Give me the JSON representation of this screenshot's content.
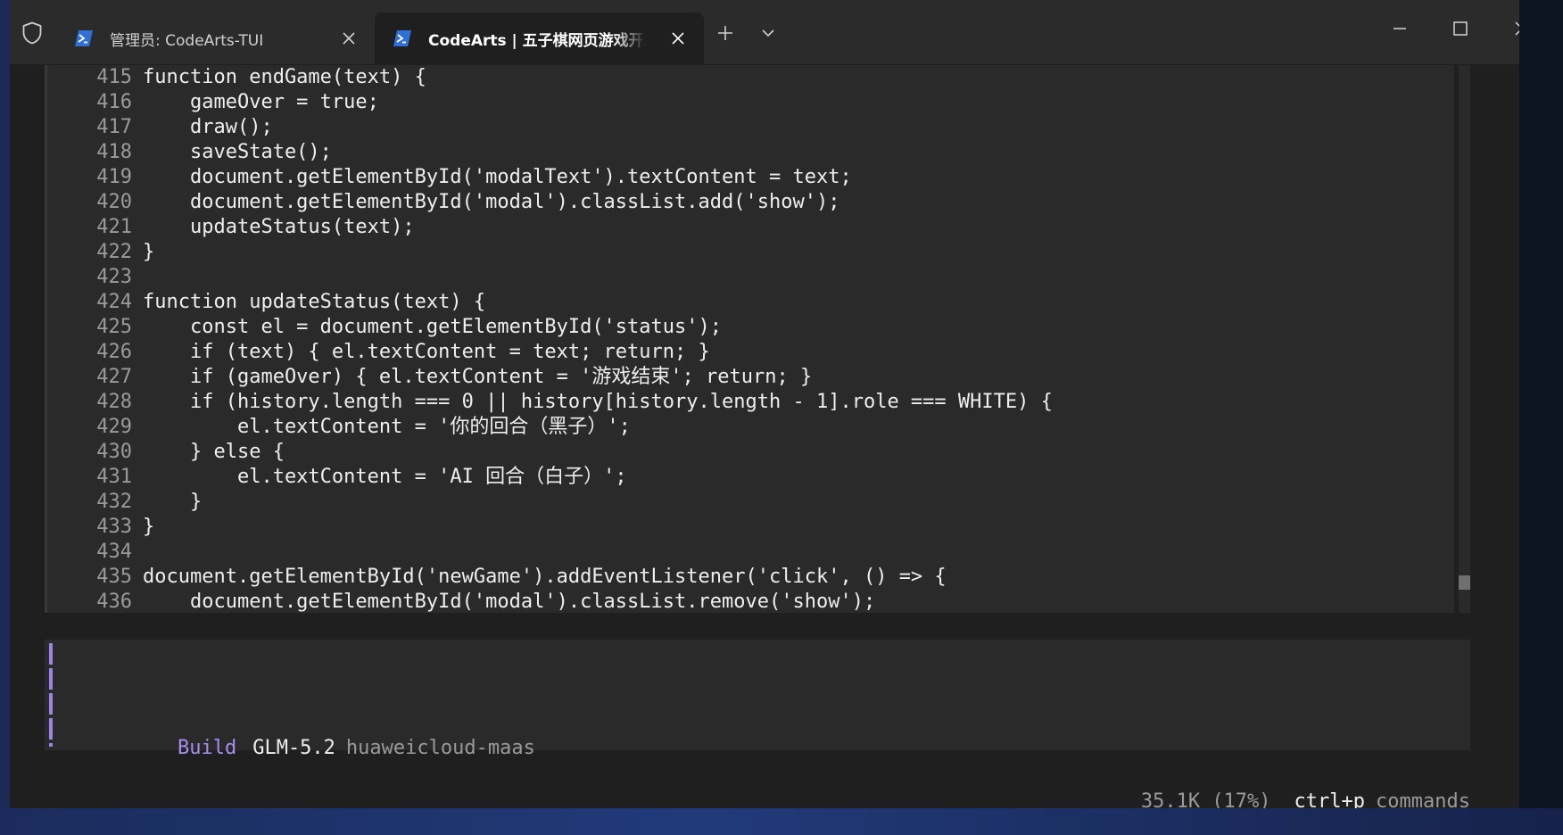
{
  "tabs": [
    {
      "title": "管理员: CodeArts-TUI",
      "active": false
    },
    {
      "title": "CodeArts | 五子棋网页游戏开发",
      "active": true
    }
  ],
  "code": [
    {
      "n": "415",
      "t": "function endGame(text) {"
    },
    {
      "n": "416",
      "t": "    gameOver = true;"
    },
    {
      "n": "417",
      "t": "    draw();"
    },
    {
      "n": "418",
      "t": "    saveState();"
    },
    {
      "n": "419",
      "t": "    document.getElementById('modalText').textContent = text;"
    },
    {
      "n": "420",
      "t": "    document.getElementById('modal').classList.add('show');"
    },
    {
      "n": "421",
      "t": "    updateStatus(text);"
    },
    {
      "n": "422",
      "t": "}"
    },
    {
      "n": "423",
      "t": ""
    },
    {
      "n": "424",
      "t": "function updateStatus(text) {"
    },
    {
      "n": "425",
      "t": "    const el = document.getElementById('status');"
    },
    {
      "n": "426",
      "t": "    if (text) { el.textContent = text; return; }"
    },
    {
      "n": "427",
      "t": "    if (gameOver) { el.textContent = '游戏结束'; return; }"
    },
    {
      "n": "428",
      "t": "    if (history.length === 0 || history[history.length - 1].role === WHITE) {"
    },
    {
      "n": "429",
      "t": "        el.textContent = '你的回合（黑子）';"
    },
    {
      "n": "430",
      "t": "    } else {"
    },
    {
      "n": "431",
      "t": "        el.textContent = 'AI 回合（白子）';"
    },
    {
      "n": "432",
      "t": "    }"
    },
    {
      "n": "433",
      "t": "}"
    },
    {
      "n": "434",
      "t": ""
    },
    {
      "n": "435",
      "t": "document.getElementById('newGame').addEventListener('click', () => {"
    },
    {
      "n": "436",
      "t": "    document.getElementById('modal').classList.remove('show');"
    }
  ],
  "prompt": {
    "mode": "Build",
    "model": "GLM-5.2",
    "provider": "huaweicloud-maas"
  },
  "status": {
    "tokens": "35.1K (17%)",
    "shortcut": "ctrl+p",
    "shortcut_label": "commands"
  },
  "colors": {
    "accent_purple": "#a98cf3",
    "terminal_bg": "#1f1f1f",
    "panel_bg": "#2a2a2a",
    "titlebar_bg": "#2b2b2b"
  },
  "icons": {
    "shield": "shield-icon",
    "powershell": "powershell-icon",
    "close": "close-icon",
    "new_tab": "plus-icon",
    "dropdown": "chevron-down-icon",
    "minimize": "minimize-icon",
    "maximize": "maximize-icon"
  }
}
